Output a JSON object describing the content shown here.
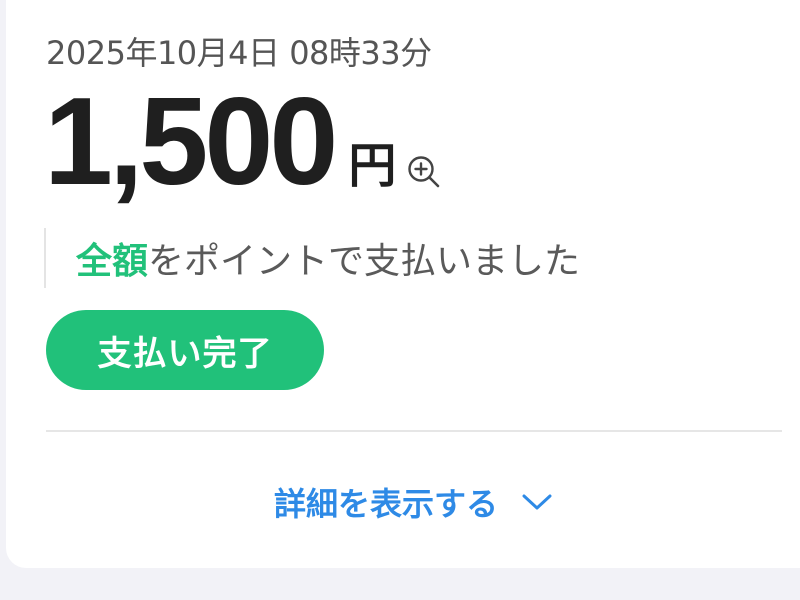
{
  "transaction": {
    "datetime": "2025年10月4日 08時33分",
    "amount": "1,500",
    "currency": "円",
    "note_highlight": "全額",
    "note_rest": "をポイントで支払いました",
    "status": "支払い完了",
    "details_link": "詳細を表示する"
  },
  "icons": {
    "zoom": "zoom-in-icon",
    "details": "chevron-down-icon"
  },
  "colors": {
    "accent_green": "#21c17a",
    "link_blue": "#2e8ae6",
    "text_dark": "#1f1f1f",
    "text_gray": "#555555"
  }
}
